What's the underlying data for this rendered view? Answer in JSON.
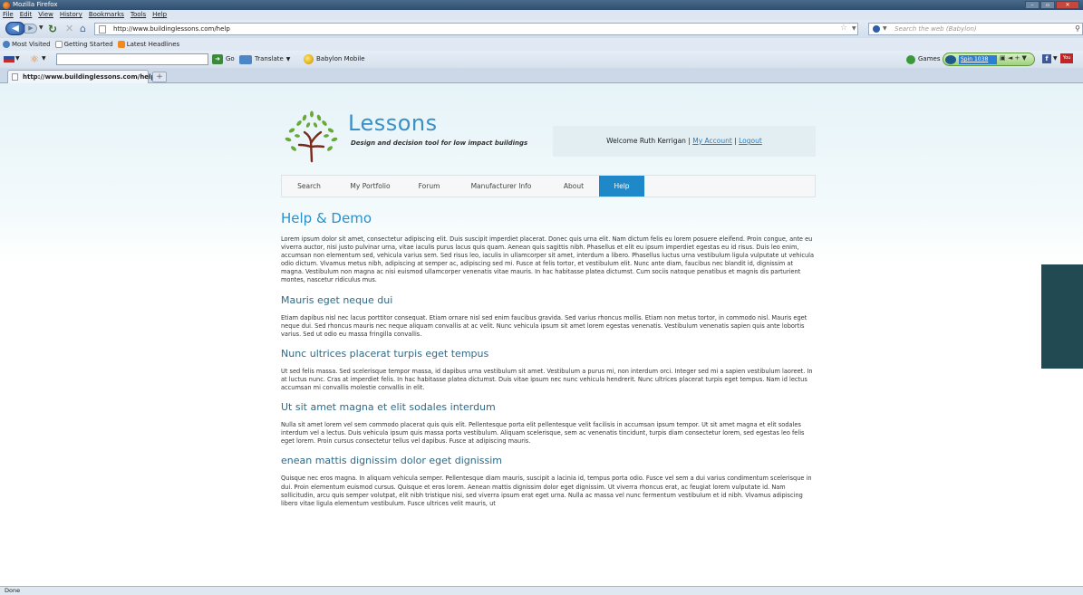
{
  "window": {
    "title": "Mozilla Firefox",
    "controls": [
      "–",
      "▫",
      "✕"
    ]
  },
  "menu": [
    "File",
    "Edit",
    "View",
    "History",
    "Bookmarks",
    "Tools",
    "Help"
  ],
  "navbar": {
    "url": "http://www.buildinglessons.com/help",
    "search_placeholder": "Search the web (Babylon)"
  },
  "bookmarks": [
    {
      "label": "Most Visited",
      "icon": "star-icon",
      "color": "#4a7fc0"
    },
    {
      "label": "Getting Started",
      "icon": "page-icon",
      "color": "#ffffff"
    },
    {
      "label": "Latest Headlines",
      "icon": "rss-icon",
      "color": "#f08a1c"
    }
  ],
  "toolbar": {
    "go_label": "Go",
    "translate_label": "Translate",
    "babylon_label": "Babylon Mobile",
    "games_label": "Games",
    "spin_label": "Spin 1038"
  },
  "tab": {
    "title": "http://www.buildinglessons.com/help",
    "new_tab": "+"
  },
  "site": {
    "logo_title": "Lessons",
    "tagline": "Design and decision tool for low impact buildings",
    "welcome_prefix": "Welcome Ruth Kerrigan |",
    "my_account": "My Account",
    "separator": "|",
    "logout": "Logout",
    "accent_color": "#1e88c8"
  },
  "nav": [
    {
      "label": "Search",
      "active": false
    },
    {
      "label": "My Portfolio",
      "active": false
    },
    {
      "label": "Forum",
      "active": false
    },
    {
      "label": "Manufacturer Info",
      "active": false
    },
    {
      "label": "About",
      "active": false
    },
    {
      "label": "Help",
      "active": true
    }
  ],
  "content": {
    "title": "Help & Demo",
    "intro": "Lorem ipsum dolor sit amet, consectetur adipiscing elit. Duis suscipit imperdiet placerat. Donec quis urna elit. Nam dictum felis eu lorem posuere eleifend. Proin congue, ante eu viverra auctor, nisi justo pulvinar urna, vitae iaculis purus lacus quis quam. Aenean quis sagittis nibh. Phasellus et elit eu ipsum imperdiet egestas eu id risus. Duis leo enim, accumsan non elementum sed, vehicula varius sem. Sed risus leo, iaculis in ullamcorper sit amet, interdum a libero. Phasellus luctus urna vestibulum ligula vulputate ut vehicula odio dictum. Vivamus metus nibh, adipiscing at semper ac, adipiscing sed mi. Fusce at felis tortor, et vestibulum elit. Nunc ante diam, faucibus nec blandit id, dignissim at magna. Vestibulum non magna ac nisi euismod ullamcorper venenatis vitae mauris. In hac habitasse platea dictumst. Cum sociis natoque penatibus et magnis dis parturient montes, nascetur ridiculus mus.",
    "sections": [
      {
        "heading": "Mauris eget neque dui",
        "body": "Etiam dapibus nisl nec lacus porttitor consequat. Etiam ornare nisl sed enim faucibus gravida. Sed varius rhoncus mollis. Etiam non metus tortor, in commodo nisl. Mauris eget neque dui. Sed rhoncus mauris nec neque aliquam convallis at ac velit. Nunc vehicula ipsum sit amet lorem egestas venenatis. Vestibulum venenatis sapien quis ante lobortis varius. Sed ut odio eu massa fringilla convallis."
      },
      {
        "heading": "Nunc ultrices placerat turpis eget tempus",
        "body": "Ut sed felis massa. Sed scelerisque tempor massa, id dapibus urna vestibulum sit amet. Vestibulum a purus mi, non interdum orci. Integer sed mi a sapien vestibulum laoreet. In at luctus nunc. Cras at imperdiet felis. In hac habitasse platea dictumst. Duis vitae ipsum nec nunc vehicula hendrerit. Nunc ultrices placerat turpis eget tempus. Nam id lectus accumsan mi convallis molestie convallis in elit."
      },
      {
        "heading": "Ut sit amet magna et elit sodales interdum",
        "body": "Nulla sit amet lorem vel sem commodo placerat quis quis elit. Pellentesque porta elit pellentesque velit facilisis in accumsan ipsum tempor. Ut sit amet magna et elit sodales interdum vel a lectus. Duis vehicula ipsum quis massa porta vestibulum. Aliquam scelerisque, sem ac venenatis tincidunt, turpis diam consectetur lorem, sed egestas leo felis eget lorem. Proin cursus consectetur tellus vel dapibus. Fusce at adipiscing mauris."
      },
      {
        "heading": "enean mattis dignissim dolor eget dignissim",
        "body": "Quisque nec eros magna. In aliquam vehicula semper. Pellentesque diam mauris, suscipit a lacinia id, tempus porta odio. Fusce vel sem a dui varius condimentum scelerisque in dui. Proin elementum euismod cursus. Quisque et eros lorem. Aenean mattis dignissim dolor eget dignissim. Ut viverra rhoncus erat, ac feugiat lorem vulputate id. Nam sollicitudin, arcu quis semper volutpat, elit nibh tristique nisi, sed viverra ipsum erat eget urna. Nulla ac massa vel nunc fermentum vestibulum et id nibh. Vivamus adipiscing libero vitae ligula elementum vestibulum. Fusce ultrices velit mauris, ut"
      }
    ]
  },
  "status": "Done"
}
